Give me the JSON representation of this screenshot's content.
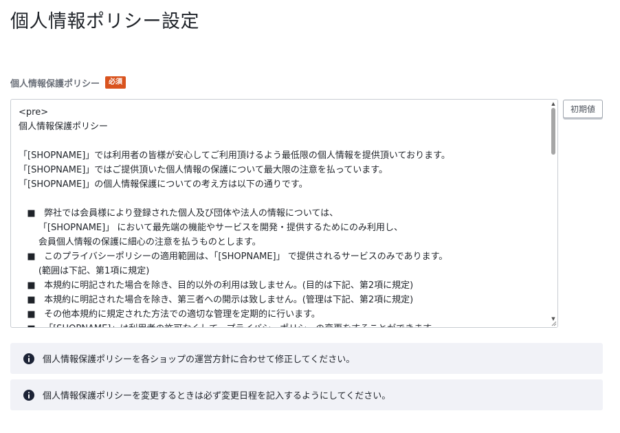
{
  "page": {
    "title": "個人情報ポリシー設定"
  },
  "field": {
    "label": "個人情報保護ポリシー",
    "required_badge": "必須",
    "reset_button_label": "初期値",
    "value": "<pre>\n個人情報保護ポリシー\n\n「[SHOPNAME]」では利用者の皆様が安心してご利用頂けるよう最低限の個人情報を提供頂いております。\n「[SHOPNAME]」ではご提供頂いた個人情報の保護について最大限の注意を払っています。\n「[SHOPNAME]」の個人情報保護についての考え方は以下の通りです。\n\n   ■   弊社では会員様により登録された個人及び団体や法人の情報については、\n       「[SHOPNAME]」 において最先端の機能やサービスを開発・提供するためにのみ利用し、\n       会員個人情報の保護に細心の注意を払うものとします。\n   ■   このプライバシーポリシーの適用範囲は、「[SHOPNAME]」 で提供されるサービスのみであります。\n       (範囲は下記、第1項に規定)\n   ■   本規約に明記された場合を除き、目的以外の利用は致しません。(目的は下記、第2項に規定)\n   ■   本規約に明記された場合を除き、第三者への開示は致しません。(管理は下記、第2項に規定)\n   ■   その他本規約に規定された方法での適切な管理を定期的に行います。\n   ■   「[SHOPNAME]」は利用者の許可なくして、プライバシーポリシーの変更をすることができます。"
  },
  "notices": [
    {
      "icon": "info-icon",
      "text": "個人情報保護ポリシーを各ショップの運営方針に合わせて修正してください。"
    },
    {
      "icon": "info-icon",
      "text": "個人情報保護ポリシーを変更するときは必ず変更日程を記入するようにしてください。"
    }
  ],
  "colors": {
    "required_badge": "#d9531e",
    "notice_background": "#f1f2f7",
    "info_icon": "#1c2336"
  }
}
